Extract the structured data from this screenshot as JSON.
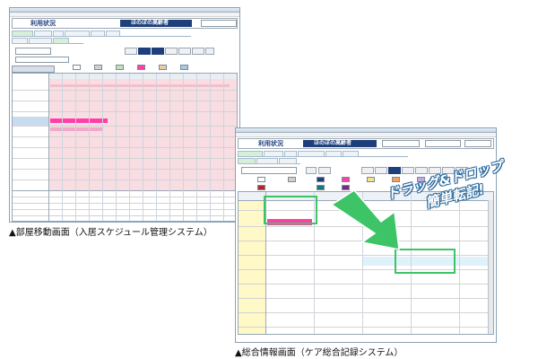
{
  "left_window": {
    "header_title": "ほのぼの高齢者",
    "header_left": "利用状況"
  },
  "right_window": {
    "header_title": "ほのぼの高齢者",
    "header_left": "利用状況"
  },
  "callout": {
    "line1": "ドラッグ&ドロップ",
    "line2": "簡単転記!"
  },
  "captions": {
    "left": "▲部屋移動画面（入居スケジュール管理システム）",
    "right": "▲総合情報画面（ケア総合記録システム）"
  },
  "colors": {
    "pink_bar": "#ff3fa7",
    "row_pink": "#f8dde3",
    "row_yellow": "#fff9c8",
    "accent_green": "#3cc466",
    "navy": "#1f3f7a"
  }
}
